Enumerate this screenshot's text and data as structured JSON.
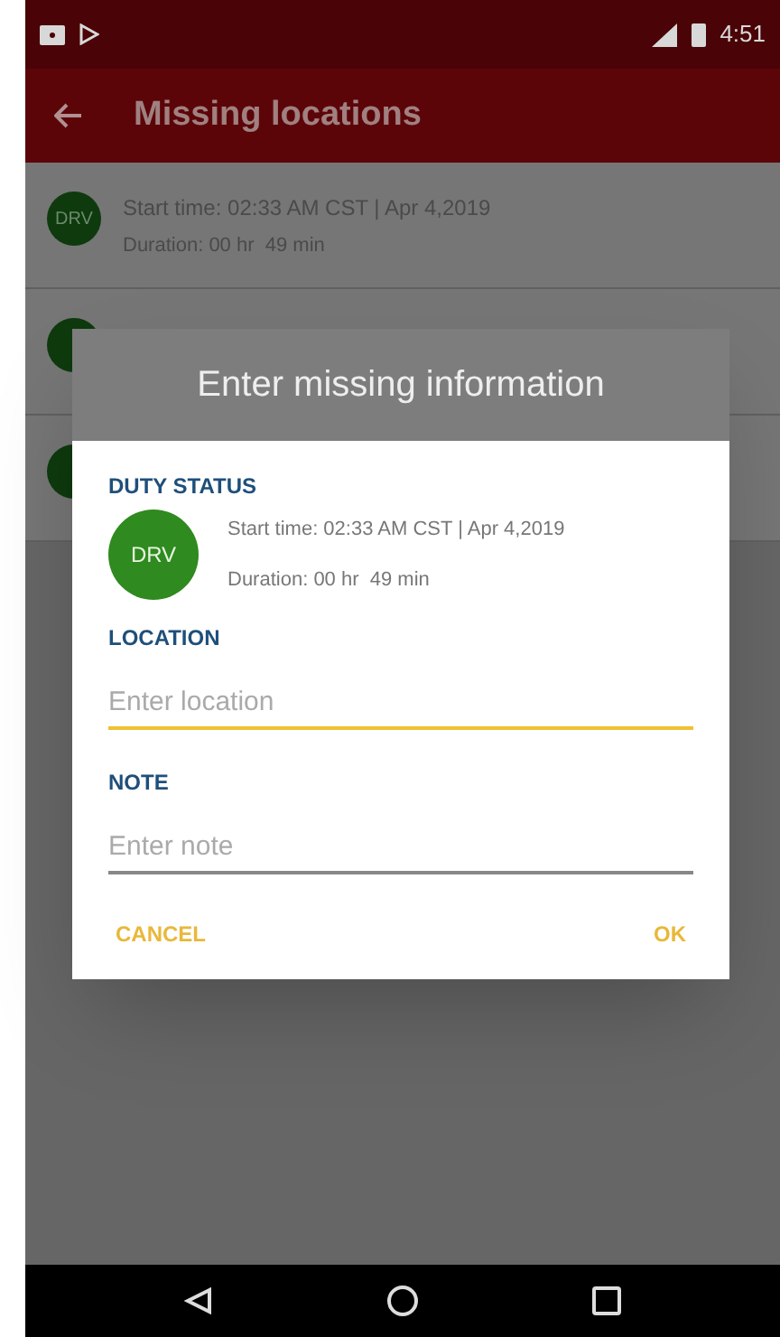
{
  "status_bar": {
    "time": "4:51"
  },
  "app_bar": {
    "title": "Missing locations"
  },
  "list": [
    {
      "kind": "full",
      "badge": "DRV",
      "start": "Start time: 02:33 AM CST | Apr 4,2019",
      "duration": "Duration: 00 hr  49 min"
    },
    {
      "kind": "covered"
    },
    {
      "kind": "covered"
    }
  ],
  "dialog": {
    "title": "Enter missing information",
    "duty_label": "DUTY STATUS",
    "badge": "DRV",
    "start": "Start time: 02:33 AM CST | Apr 4,2019",
    "duration": "Duration: 00 hr  49 min",
    "fields": [
      {
        "label": "LOCATION",
        "placeholder": "Enter location",
        "focused": true
      },
      {
        "label": "NOTE",
        "placeholder": "Enter note",
        "focused": false
      }
    ],
    "buttons": [
      "CANCEL",
      "OK"
    ]
  }
}
